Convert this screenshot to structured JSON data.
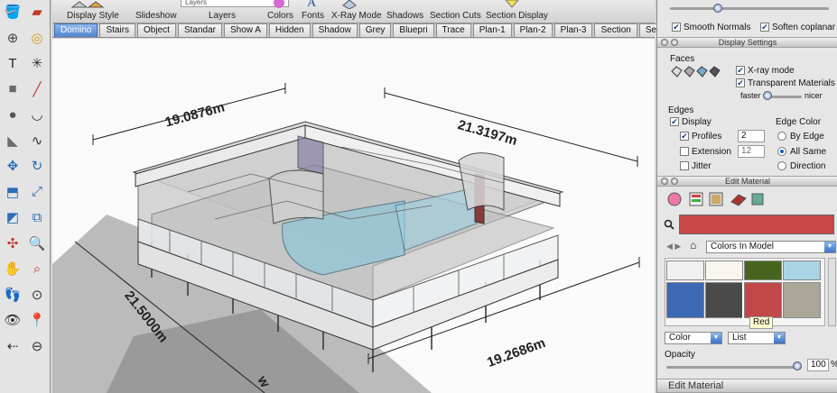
{
  "toolbar": {
    "layers_field_value": "Layers",
    "labels": [
      "Display Style",
      "Slideshow",
      "Layers",
      "Colors",
      "Fonts",
      "X-Ray Mode",
      "Shadows",
      "Section Cuts",
      "Section Display"
    ]
  },
  "scene_tabs": [
    "Domino",
    "Stairs",
    "Object",
    "Standar",
    "Show A",
    "Hidden",
    "Shadow",
    "Grey",
    "Bluepri",
    "Trace",
    "Plan-1",
    "Plan-2",
    "Plan-3",
    "Section",
    "Section"
  ],
  "active_tab_index": 0,
  "palette_tools": [
    "paint-bucket-icon",
    "eraser-icon",
    "orbit-icon",
    "tape-measure-icon",
    "text-icon",
    "axes-icon",
    "rectangle-icon",
    "line-icon",
    "circle-icon",
    "arc-icon",
    "polygon-icon",
    "freehand-icon",
    "move-icon",
    "rotate-icon",
    "push-pull-icon",
    "scale-icon",
    "section-plane-icon",
    "offset-icon",
    "follow-me-icon",
    "zoom-icon",
    "pan-icon",
    "zoom-window-icon",
    "walk-icon",
    "zoom-extents-icon",
    "look-around-icon",
    "position-camera-icon",
    "previous-view-icon",
    "next-view-icon"
  ],
  "viewport": {
    "dimensions": [
      "19.0876m",
      "21.3197m",
      "21.5000m",
      "19.2686m"
    ],
    "partial_label": "w"
  },
  "top_panel": {
    "smooth_normals": "Smooth Normals",
    "smooth_normals_checked": true,
    "soften_coplanar": "Soften coplanar",
    "soften_coplanar_checked": true
  },
  "display_settings": {
    "title": "Display Settings",
    "faces_label": "Faces",
    "xray_label": "X-ray mode",
    "xray_checked": true,
    "transparent_label": "Transparent Materials",
    "transparent_checked": true,
    "faster_label": "faster",
    "nicer_label": "nicer",
    "edges_label": "Edges",
    "display_label": "Display",
    "display_checked": true,
    "profiles_label": "Profiles",
    "profiles_checked": true,
    "profiles_value": "2",
    "extension_label": "Extension",
    "extension_checked": false,
    "extension_value": "12",
    "jitter_label": "Jitter",
    "jitter_checked": false,
    "edge_color_label": "Edge Color",
    "by_edge_label": "By Edge",
    "all_same_label": "All Same",
    "direction_label": "Direction",
    "edge_color_selected": "All Same"
  },
  "edit_material": {
    "title": "Edit Material",
    "current_color": "#c84848",
    "library_label": "Colors In Model",
    "swatches": [
      "#f0f0f0",
      "#f8f6ee",
      "#46641e",
      "#a8d4e4",
      "#3c68b4",
      "#4a4a4a",
      "#c04848",
      "#aca698"
    ],
    "selected_swatch": 6,
    "tooltip": "Red",
    "color_dropdown": "Color",
    "list_dropdown": "List",
    "opacity_label": "Opacity",
    "opacity_value": "100",
    "opacity_unit": "%",
    "footer_title": "Edit Material"
  }
}
